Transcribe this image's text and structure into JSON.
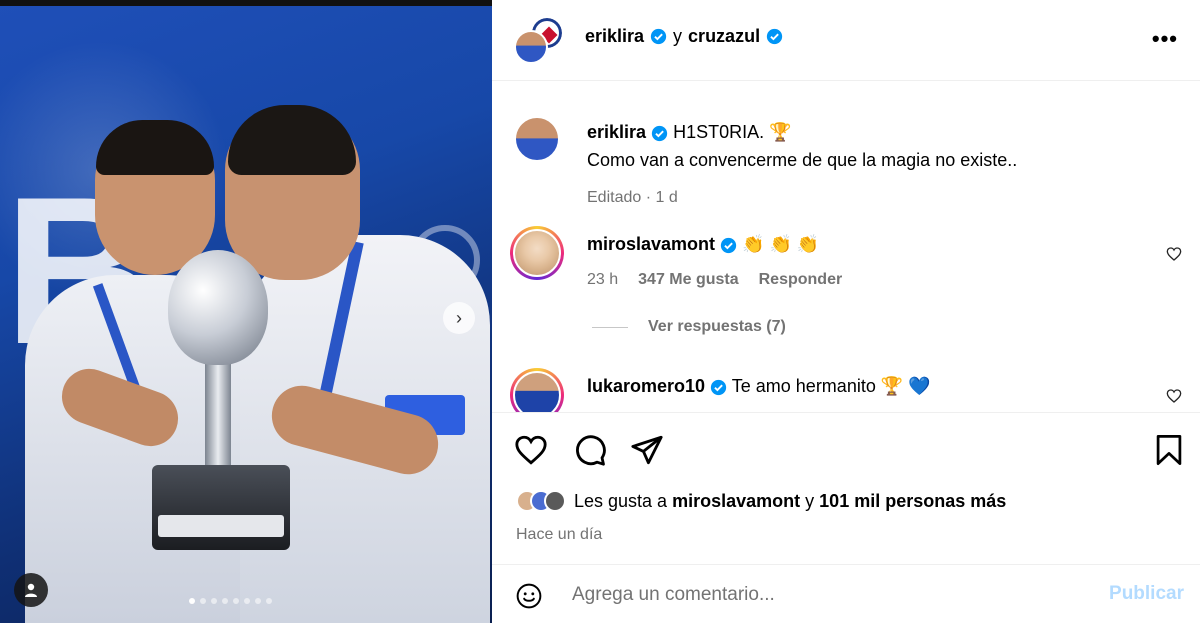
{
  "post": {
    "author": "eriklira",
    "connector": "y",
    "collaborator": "cruzazul",
    "more_icon": "more-horizontal-icon"
  },
  "media": {
    "dots_total": 8,
    "dot_active": 0,
    "next_icon": "chevron-right-icon",
    "tag_icon": "user-tag-icon"
  },
  "caption": {
    "user": "eriklira",
    "title_text": "H1ST0RIA.",
    "title_emoji": "🏆",
    "body": "Como van a convencerme de que la magia no existe..",
    "meta": "Editado · 1 d"
  },
  "comments": [
    {
      "user": "miroslavamont",
      "emojis": "👏 👏 👏",
      "time": "23 h",
      "likes": "347 Me gusta",
      "reply": "Responder",
      "view_replies": "Ver respuestas (7)"
    },
    {
      "user": "lukaromero10",
      "text": "Te amo hermanito",
      "emojis": "🏆 💙"
    }
  ],
  "actions": {
    "like_icon": "heart-icon",
    "comment_icon": "comment-bubble-icon",
    "share_icon": "send-icon",
    "save_icon": "bookmark-icon"
  },
  "likes": {
    "prefix": "Les gusta a",
    "user": "miroslavamont",
    "and": "y",
    "others": "101 mil personas más"
  },
  "posted": "Hace un día",
  "composer": {
    "placeholder": "Agrega un comentario...",
    "publish": "Publicar",
    "emoji_icon": "smiley-icon"
  },
  "colors": {
    "verified": "#0095f6",
    "meta_gray": "#737373",
    "publish_disabled": "#b3dbff",
    "border": "#efefef"
  }
}
